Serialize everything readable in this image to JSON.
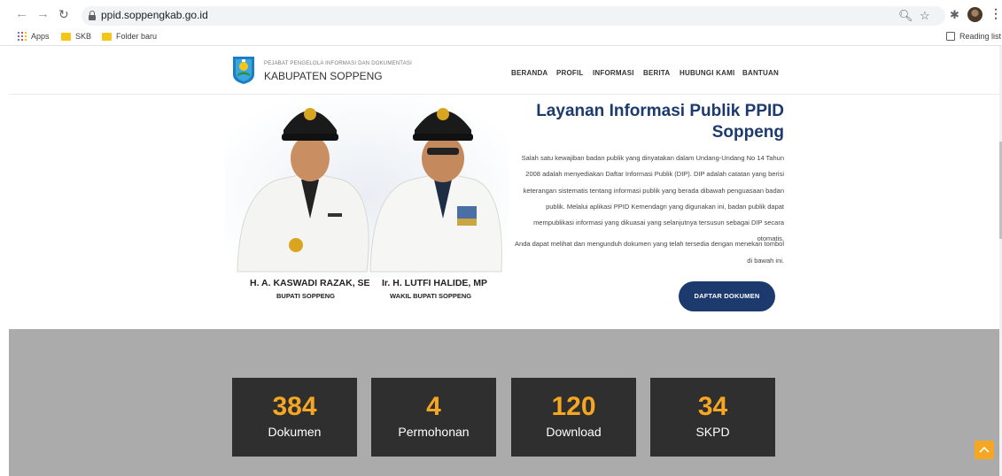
{
  "browser": {
    "url": "ppid.soppengkab.go.id",
    "bookmarks": [
      "Apps",
      "SKB",
      "Folder baru"
    ],
    "reading_list": "Reading list",
    "icons": [
      "back-icon",
      "forward-icon",
      "reload-icon",
      "lock-icon",
      "zoom-icon",
      "star-icon",
      "extensions-icon",
      "profile-avatar",
      "more-menu-icon"
    ]
  },
  "site": {
    "brand_small": "PEJABAT PENGELOLA INFORMASI DAN DOKUMENTASI",
    "brand_big": "KABUPATEN SOPPENG",
    "menu": [
      "BERANDA",
      "PROFIL",
      "INFORMASI",
      "BERITA",
      "HUBUNGI KAMI",
      "BANTUAN"
    ]
  },
  "hero": {
    "officials": [
      {
        "name": "H. A. KASWADI RAZAK, SE",
        "role": "BUPATI SOPPENG"
      },
      {
        "name": "Ir. H. LUTFI HALIDE, MP",
        "role": "WAKIL BUPATI SOPPENG"
      }
    ],
    "title_line1": "Layanan Informasi Publik PPID",
    "title_line2": "Soppeng",
    "paragraph1": "Salah satu kewajiban badan publik yang dinyatakan dalam Undang-Undang No 14 Tahun 2008 adalah menyediakan Daftar Informasi Publik (DIP). DIP adalah catatan yang berisi keterangan sistematis tentang informasi publik yang berada dibawah penguasaan badan publik. Melalui aplikasi PPID Kemendagri yang digunakan ini, badan publik dapat mempublikasi informasi yang dikuasai yang selanjutnya tersusun sebagai DIP secara otomatis.",
    "paragraph2": "Anda dapat melihat dan mengunduh dokumen yang telah tersedia dengan menekan tombol di bawah ini.",
    "button": "DAFTAR DOKUMEN"
  },
  "stats": [
    {
      "value": "384",
      "label": "Dokumen"
    },
    {
      "value": "4",
      "label": "Permohonan"
    },
    {
      "value": "120",
      "label": "Download"
    },
    {
      "value": "34",
      "label": "SKPD"
    }
  ],
  "colors": {
    "accent": "#1c3a6e",
    "stat_number": "#f5a623",
    "stat_box": "#2f2f2f",
    "stats_background": "#ababab"
  }
}
